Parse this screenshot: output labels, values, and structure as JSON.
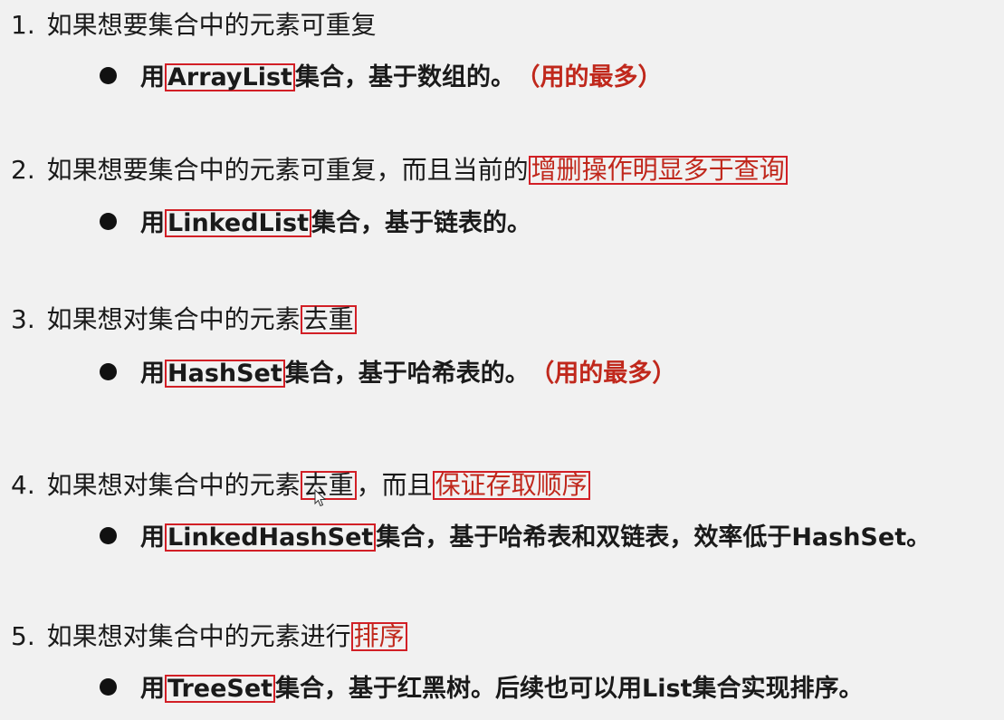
{
  "items": [
    {
      "num": "1.",
      "question": {
        "pre": "如果想要集合中的元素可重复",
        "boxed": "",
        "post": "",
        "boxed2": ""
      },
      "answer": {
        "pre": "用",
        "boxed": "ArrayList",
        "post": "集合，基于数组的。",
        "tag": "（用的最多）"
      }
    },
    {
      "num": "2.",
      "question": {
        "pre": "如果想要集合中的元素可重复，而且当前的",
        "boxed": "增删操作明显多于查询",
        "post": "",
        "boxed2": ""
      },
      "answer": {
        "pre": "用",
        "boxed": "LinkedList",
        "post": "集合，基于链表的。",
        "tag": ""
      }
    },
    {
      "num": "3.",
      "question": {
        "pre": "如果想对集合中的元素",
        "boxed": "去重",
        "post": "",
        "boxed2": ""
      },
      "answer": {
        "pre": "用",
        "boxed": "HashSet",
        "post": "集合，基于哈希表的。",
        "tag": "（用的最多）"
      }
    },
    {
      "num": "4.",
      "question": {
        "pre": "如果想对集合中的元素",
        "boxed": "去重",
        "post": "，而且",
        "boxed2": "保证存取顺序"
      },
      "answer": {
        "pre": "用",
        "boxed": "LinkedHashSet",
        "post": "集合，基于哈希表和双链表，效率低于HashSet。",
        "tag": ""
      }
    },
    {
      "num": "5.",
      "question": {
        "pre": "如果想对集合中的元素进行",
        "boxed": "排序",
        "post": "",
        "boxed2": ""
      },
      "answer": {
        "pre": "用",
        "boxed": "TreeSet",
        "post": "集合，基于红黑树。后续也可以用List集合实现排序。",
        "tag": ""
      }
    }
  ],
  "colors": {
    "highlight_box": "#d21f26",
    "highlight_text": "#c0281c",
    "background": "#f1f1f1"
  },
  "icons": {
    "cursor": "mouse-pointer-icon",
    "bullet": "filled-circle-bullet"
  }
}
